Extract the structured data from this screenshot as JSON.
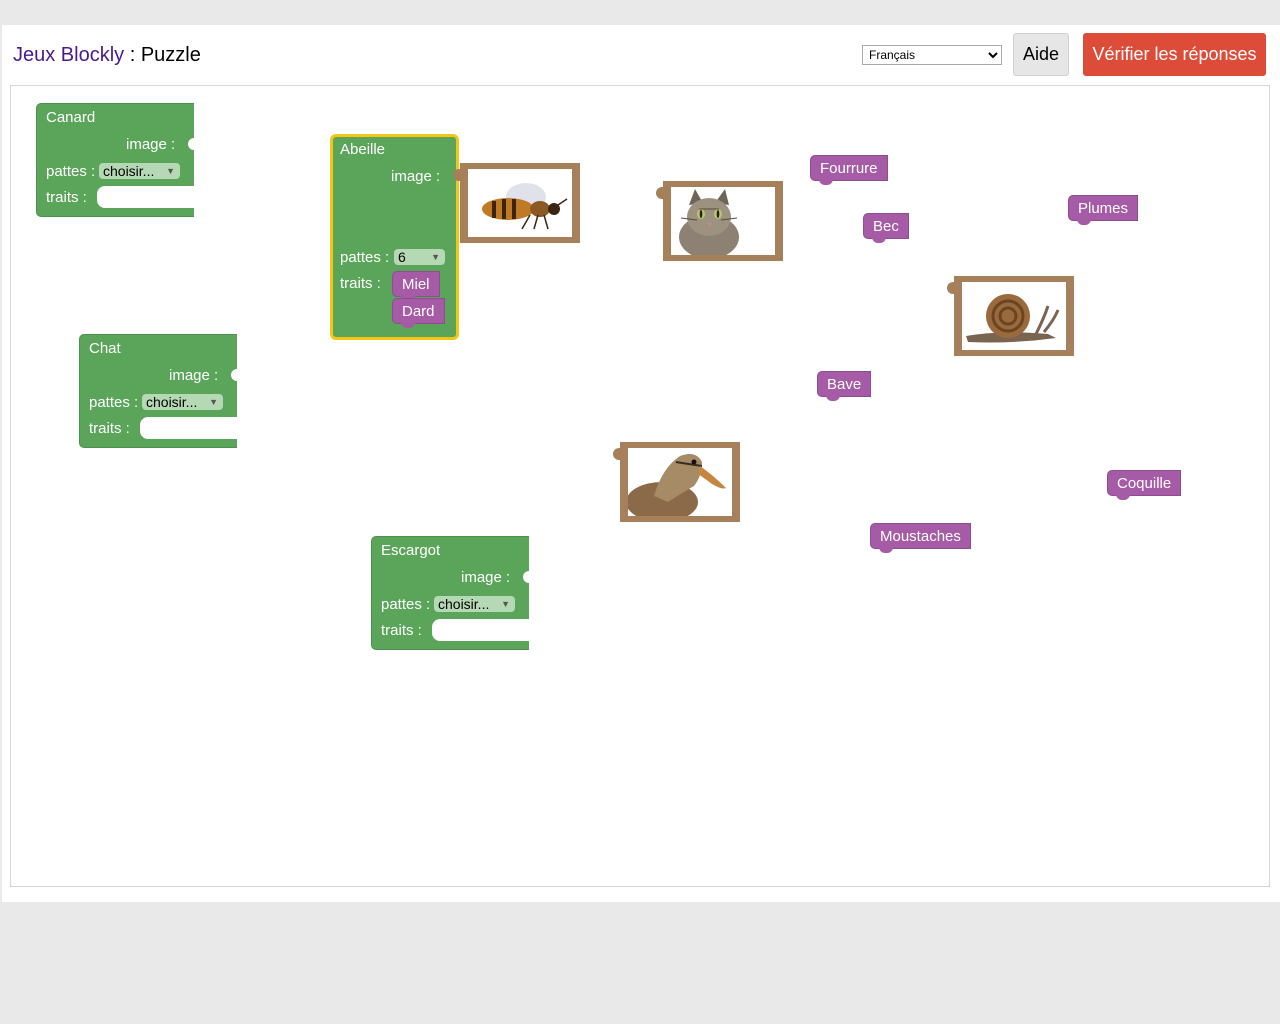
{
  "header": {
    "app_title": "Jeux Blockly",
    "separator": " : ",
    "page_title": "Puzzle",
    "language": {
      "selected": "Français"
    },
    "help_label": "Aide",
    "verify_label": "Vérifier les réponses"
  },
  "colors": {
    "animal_block": "#5ba55b",
    "trait_block": "#a55ba5",
    "image_block": "#a5805b",
    "selected_outline": "#f5c518",
    "verify_button": "#dd4b39",
    "title_link": "#4a1a8c"
  },
  "animals": [
    {
      "name": "Canard",
      "image_label": "image :",
      "legs_label": "pattes :",
      "legs_value": "choisir...",
      "traits_label": "traits :"
    },
    {
      "name": "Abeille",
      "image_label": "image :",
      "legs_label": "pattes :",
      "legs_value": "6",
      "traits_label": "traits :",
      "attached_traits": [
        "Miel",
        "Dard"
      ]
    },
    {
      "name": "Chat",
      "image_label": "image :",
      "legs_label": "pattes :",
      "legs_value": "choisir...",
      "traits_label": "traits :"
    },
    {
      "name": "Escargot",
      "image_label": "image :",
      "legs_label": "pattes :",
      "legs_value": "choisir...",
      "traits_label": "traits :"
    }
  ],
  "free_traits": [
    "Fourrure",
    "Bec",
    "Plumes",
    "Bave",
    "Coquille",
    "Moustaches"
  ],
  "images": [
    "bee",
    "cat",
    "snail",
    "duck"
  ]
}
